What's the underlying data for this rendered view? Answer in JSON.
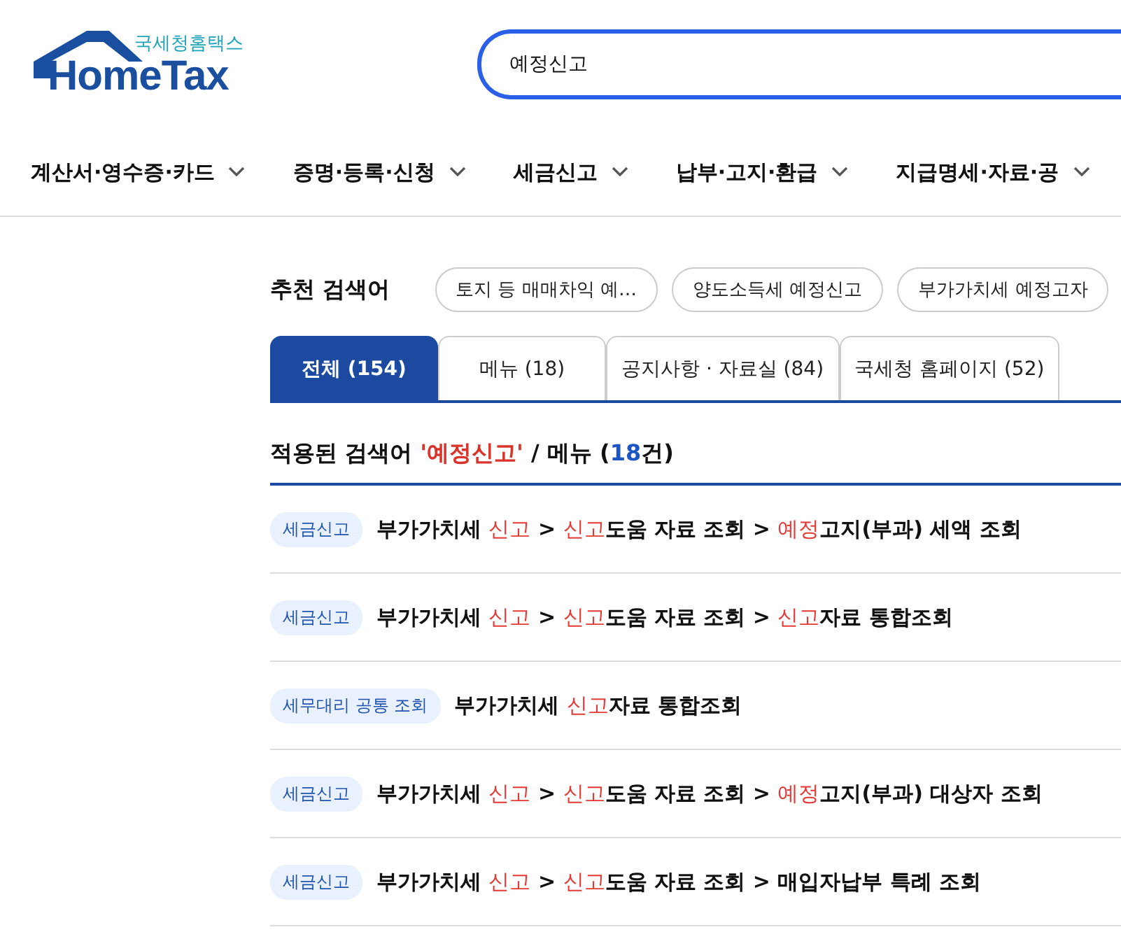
{
  "logo": {
    "subtitle": "국세청홈택스",
    "title": "HomeTax"
  },
  "search": {
    "value": "예정신고"
  },
  "nav": [
    {
      "label": "계산서·영수증·카드"
    },
    {
      "label": "증명·등록·신청"
    },
    {
      "label": "세금신고"
    },
    {
      "label": "납부·고지·환급"
    },
    {
      "label": "지급명세·자료·공"
    }
  ],
  "recommended": {
    "label": "추천 검색어",
    "chips": [
      "토지 등 매매차익 예…",
      "양도소득세 예정신고",
      "부가가치세 예정고자"
    ]
  },
  "tabs": [
    {
      "label": "전체 (154)",
      "selected": true
    },
    {
      "label": "메뉴 (18)",
      "selected": false
    },
    {
      "label": "공지사항 · 자료실 (84)",
      "selected": false
    },
    {
      "label": "국세청 홈페이지 (52)",
      "selected": false
    }
  ],
  "heading": [
    {
      "text": "적용된 검색어 ",
      "kind": "plain"
    },
    {
      "text": "'예정신고'",
      "kind": "keyword"
    },
    {
      "text": " / 메뉴 (",
      "kind": "plain"
    },
    {
      "text": "18",
      "kind": "count"
    },
    {
      "text": "건)",
      "kind": "plain"
    }
  ],
  "results": [
    {
      "tag": "세금신고",
      "segments": [
        {
          "text": "부가가치세 ",
          "highlight": false
        },
        {
          "text": "신고",
          "highlight": true
        },
        {
          "text": " > ",
          "highlight": false
        },
        {
          "text": "신고",
          "highlight": true
        },
        {
          "text": "도움 자료 조회 > ",
          "highlight": false
        },
        {
          "text": "예정",
          "highlight": true
        },
        {
          "text": "고지(부과) 세액 조회",
          "highlight": false
        }
      ]
    },
    {
      "tag": "세금신고",
      "segments": [
        {
          "text": "부가가치세 ",
          "highlight": false
        },
        {
          "text": "신고",
          "highlight": true
        },
        {
          "text": " > ",
          "highlight": false
        },
        {
          "text": "신고",
          "highlight": true
        },
        {
          "text": "도움 자료 조회 > ",
          "highlight": false
        },
        {
          "text": "신고",
          "highlight": true
        },
        {
          "text": "자료 통합조회",
          "highlight": false
        }
      ]
    },
    {
      "tag": "세무대리 공통 조회",
      "segments": [
        {
          "text": "부가가치세 ",
          "highlight": false
        },
        {
          "text": "신고",
          "highlight": true
        },
        {
          "text": "자료 통합조회",
          "highlight": false
        }
      ]
    },
    {
      "tag": "세금신고",
      "segments": [
        {
          "text": "부가가치세 ",
          "highlight": false
        },
        {
          "text": "신고",
          "highlight": true
        },
        {
          "text": " > ",
          "highlight": false
        },
        {
          "text": "신고",
          "highlight": true
        },
        {
          "text": "도움 자료 조회 > ",
          "highlight": false
        },
        {
          "text": "예정",
          "highlight": true
        },
        {
          "text": "고지(부과) 대상자 조회",
          "highlight": false
        }
      ]
    },
    {
      "tag": "세금신고",
      "segments": [
        {
          "text": "부가가치세 ",
          "highlight": false
        },
        {
          "text": "신고",
          "highlight": true
        },
        {
          "text": " > ",
          "highlight": false
        },
        {
          "text": "신고",
          "highlight": true
        },
        {
          "text": "도움 자료 조회 > 매입자납부 특례 조회",
          "highlight": false
        }
      ]
    }
  ]
}
